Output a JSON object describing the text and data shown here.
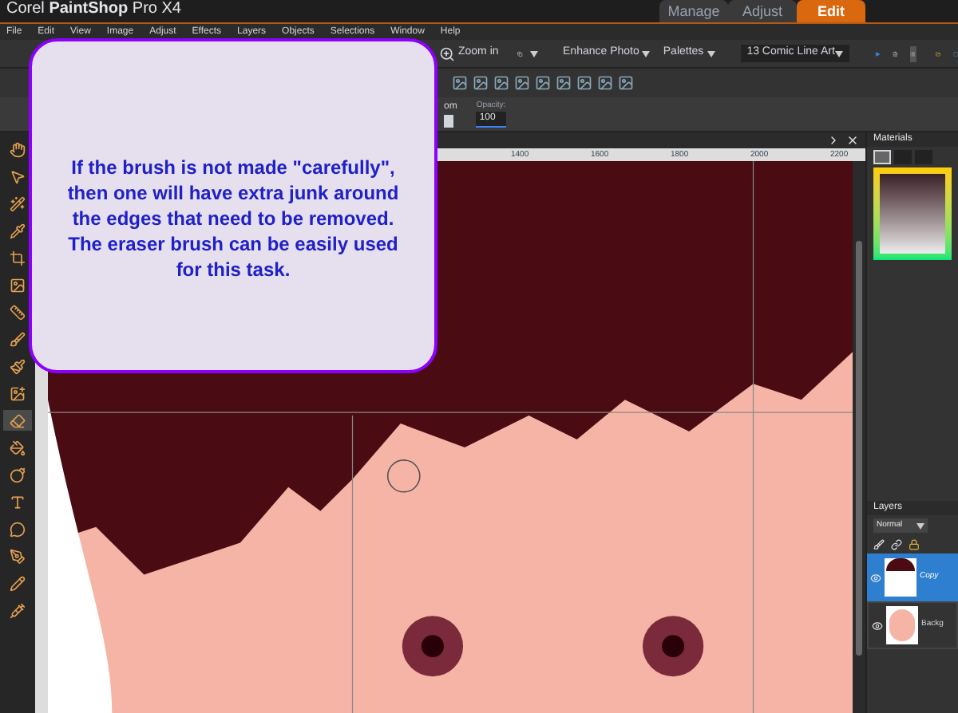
{
  "window": {
    "title": "Corel **PaintShop** Pro X4"
  },
  "workspace_tabs": [
    {
      "label": "Manage",
      "selected": false
    },
    {
      "label": "Adjust",
      "selected": false
    },
    {
      "label": "Edit",
      "selected": true
    }
  ],
  "menu": [
    "File",
    "Edit",
    "View",
    "Image",
    "Adjust",
    "Effects",
    "Layers",
    "Objects",
    "Selections",
    "Window",
    "Help"
  ],
  "toolbar": {
    "zoom": "Zoom in",
    "enhance": "Enhance Photo",
    "palettes": "Palettes",
    "preset": "13 Comic Line Art"
  },
  "tool_options": {
    "cut_label": "om",
    "opacity_label": "Opacity:",
    "opacity_value": "100"
  },
  "ruler": [
    "1400",
    "1600",
    "1800",
    "2000",
    "2200"
  ],
  "tools": [
    {
      "selected": false
    },
    {
      "selected": false
    },
    {
      "selected": false
    },
    {
      "selected": false
    },
    {
      "selected": false
    },
    {
      "selected": false
    },
    {
      "selected": false
    },
    {
      "selected": false
    },
    {
      "selected": false
    },
    {
      "selected": false
    },
    {
      "selected": true
    },
    {
      "selected": false
    },
    {
      "selected": false
    },
    {
      "selected": false
    },
    {
      "selected": false
    },
    {
      "selected": false
    },
    {
      "selected": false
    },
    {
      "selected": false
    }
  ],
  "materials": {
    "title": "Materials",
    "tabs": [
      {
        "selected": true
      },
      {
        "selected": false
      },
      {
        "selected": false
      }
    ]
  },
  "layers": {
    "title": "Layers",
    "blend_mode": "Normal",
    "items": [
      {
        "name": "Copy",
        "selected": true,
        "kind": "hair"
      },
      {
        "name": "Backg",
        "selected": false,
        "kind": "face"
      }
    ]
  },
  "callout": {
    "text": "If the brush is not made \"carefully\", then one will have extra junk around the edges that need to be removed. The eraser brush can be easily used for this task."
  }
}
